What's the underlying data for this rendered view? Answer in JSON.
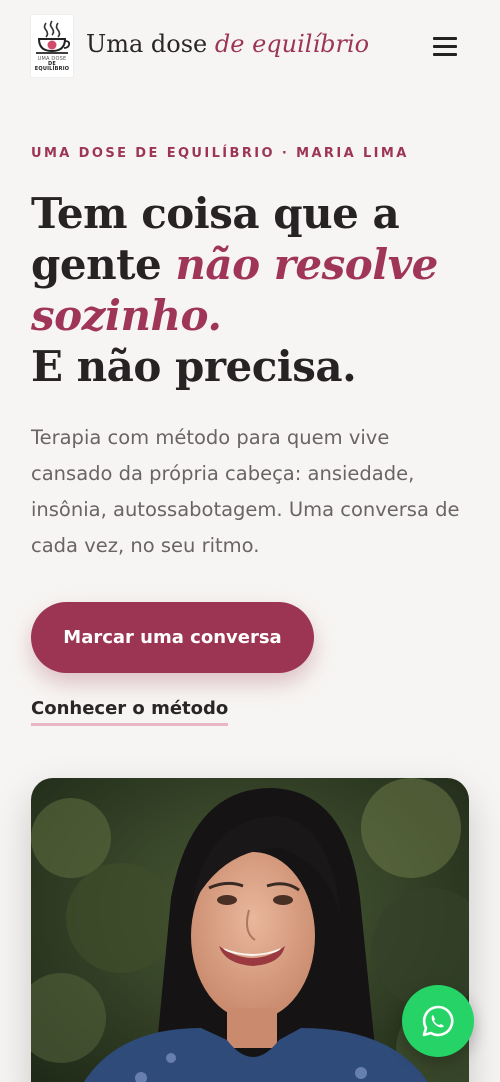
{
  "header": {
    "logo_line1": "UMA DOSE",
    "logo_line2": "DE EQUILÍBRIO",
    "brand_plain": "Uma dose ",
    "brand_accent": "de equilíbrio",
    "menu_icon": "hamburger-icon"
  },
  "hero": {
    "eyebrow": "UMA DOSE DE EQUILÍBRIO · MARIA LIMA",
    "headline_part1": "Tem coisa que a gente ",
    "headline_accent": "não resolve sozinho.",
    "headline_part2": "E não precisa.",
    "lead": "Terapia com método para quem vive cansado da própria cabeça: ansiedade, insônia, autossabotagem. Uma conversa de cada vez, no seu ritmo.",
    "cta_label": "Marcar uma conversa",
    "secondary_link": "Conhecer o método"
  },
  "floating": {
    "whatsapp_icon": "whatsapp-icon"
  },
  "colors": {
    "accent": "#9c3558",
    "cta": "#9c3553",
    "whatsapp": "#25d366",
    "background": "#f7f5f3"
  }
}
